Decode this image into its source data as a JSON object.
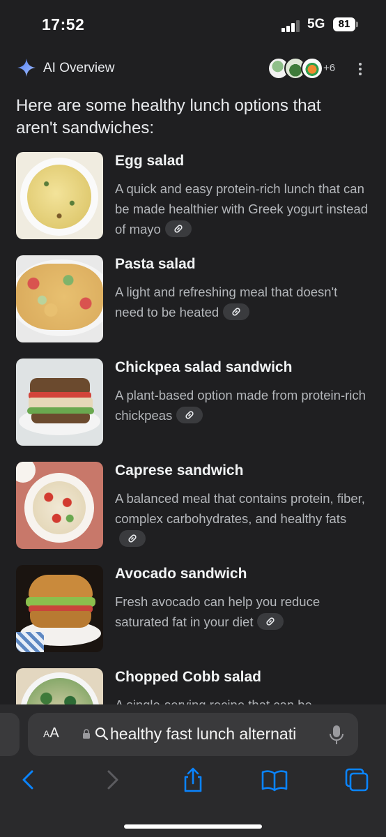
{
  "status": {
    "time": "17:52",
    "network": "5G",
    "battery": "81"
  },
  "ai_overview": {
    "title": "AI Overview",
    "sources_more": "+6"
  },
  "intro": "Here are some healthy lunch options that aren't sandwiches:",
  "items": [
    {
      "title": "Egg salad",
      "desc": "A quick and easy protein-rich lunch that can be made healthier with Greek yogurt instead of mayo"
    },
    {
      "title": "Pasta salad",
      "desc": "A light and refreshing meal that doesn't need to be heated"
    },
    {
      "title": "Chickpea salad sandwich",
      "desc": "A plant-based option made from protein-rich chickpeas"
    },
    {
      "title": "Caprese sandwich",
      "desc": "A balanced meal that contains protein, fiber, complex carbohydrates, and healthy fats"
    },
    {
      "title": "Avocado sandwich",
      "desc": "Fresh avocado can help you reduce saturated fat in your diet"
    },
    {
      "title": "Chopped Cobb salad",
      "desc": "A single-serving recipe that can be"
    }
  ],
  "browser": {
    "text_size_label": "AA",
    "address_text": "healthy fast lunch alternati"
  },
  "colors": {
    "background": "#1f1f21",
    "accent": "#0a84ff",
    "sparkle": "#8ab4f8"
  }
}
